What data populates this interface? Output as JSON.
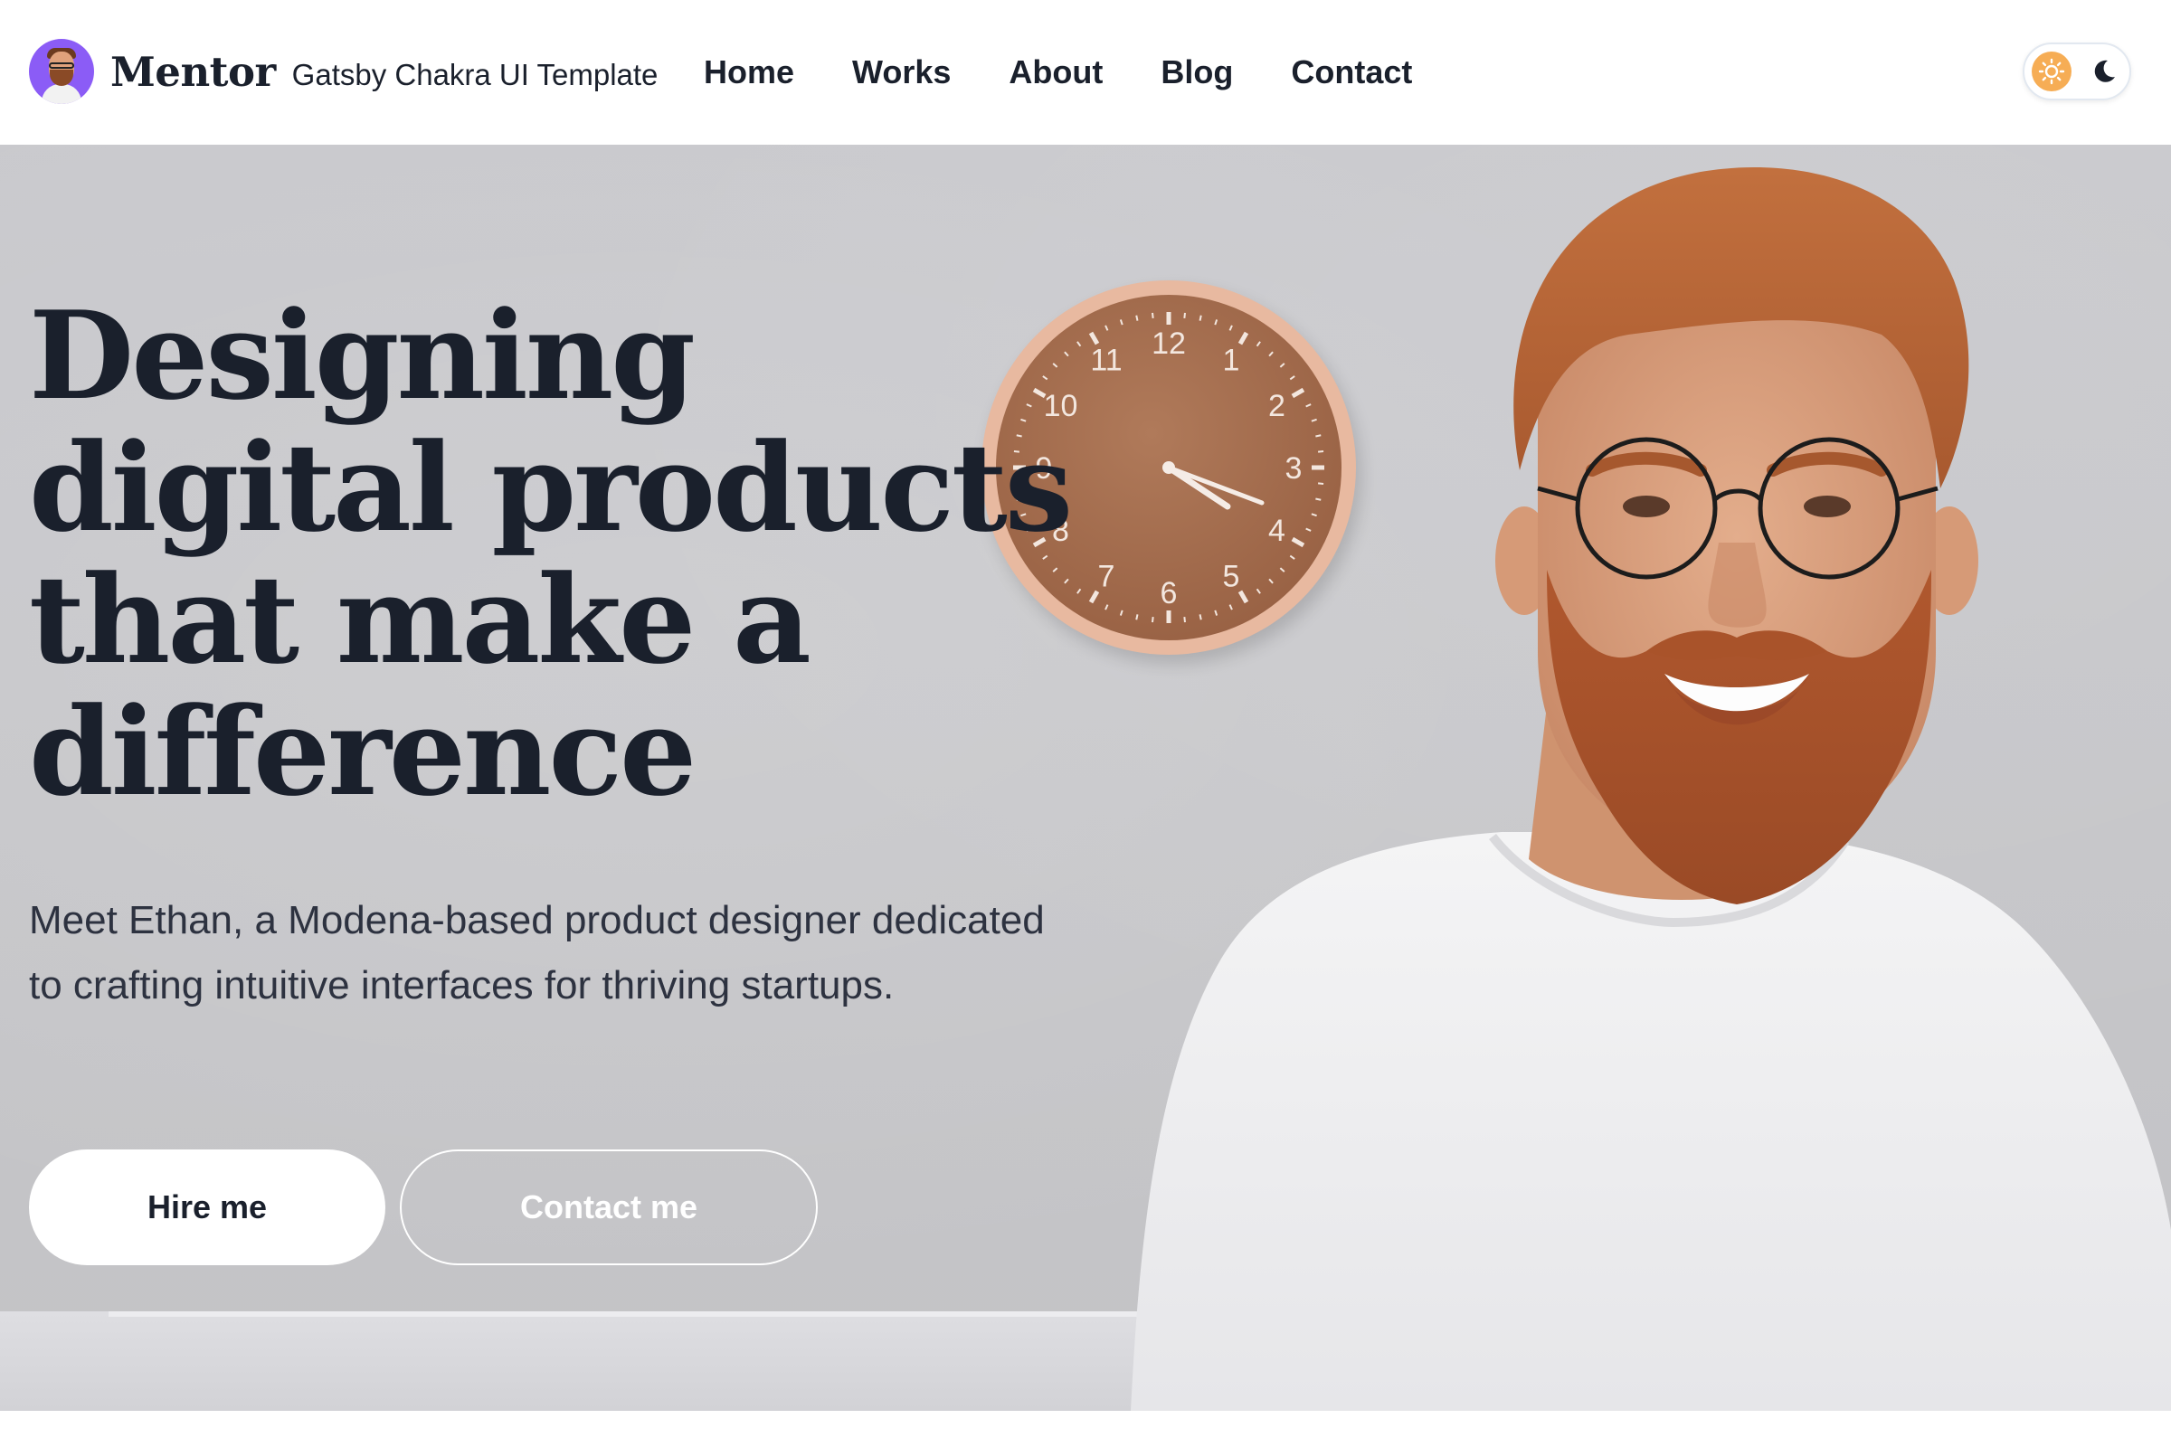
{
  "navbar": {
    "brand_name": "Mentor",
    "brand_subtitle": "Gatsby Chakra UI Template",
    "avatar": "avatar-icon",
    "links": [
      {
        "label": "Home"
      },
      {
        "label": "Works"
      },
      {
        "label": "About"
      },
      {
        "label": "Blog"
      },
      {
        "label": "Contact"
      }
    ],
    "theme_toggle": {
      "light_icon": "sun-icon",
      "dark_icon": "moon-icon",
      "active": "light"
    }
  },
  "hero": {
    "headline": "Designing digital products that make a difference",
    "subtitle": "Meet Ethan, a Modena-based product designer dedicated to crafting intuitive interfaces for thriving startups.",
    "primary_button": "Hire me",
    "secondary_button": "Contact me",
    "clock_numbers": [
      "12",
      "1",
      "2",
      "3",
      "4",
      "5",
      "6",
      "7",
      "8",
      "9",
      "10",
      "11"
    ]
  },
  "colors": {
    "text": "#1a202c",
    "accent_avatar": "#8b5cf6",
    "toggle_sun": "#f6ad55",
    "hero_bg": "#c7c7ca",
    "button_primary_bg": "#ffffff"
  }
}
